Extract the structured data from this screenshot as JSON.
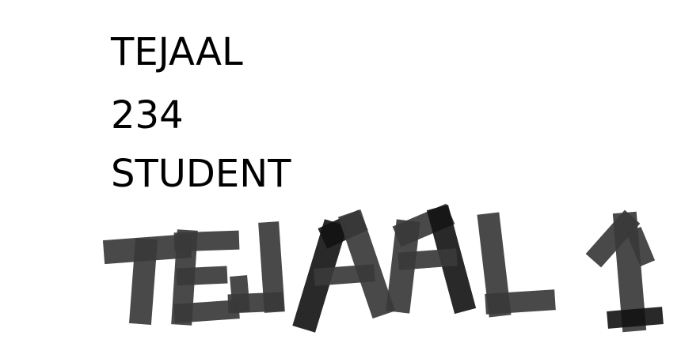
{
  "text_lines": [
    "TEJAAL",
    "234",
    "STUDENT"
  ],
  "painted_text": "TEJAAL 1",
  "colors": {
    "background": "#ffffff",
    "text": "#000000",
    "paint_mid": "#3a3a3a",
    "paint_dark": "#121212"
  }
}
